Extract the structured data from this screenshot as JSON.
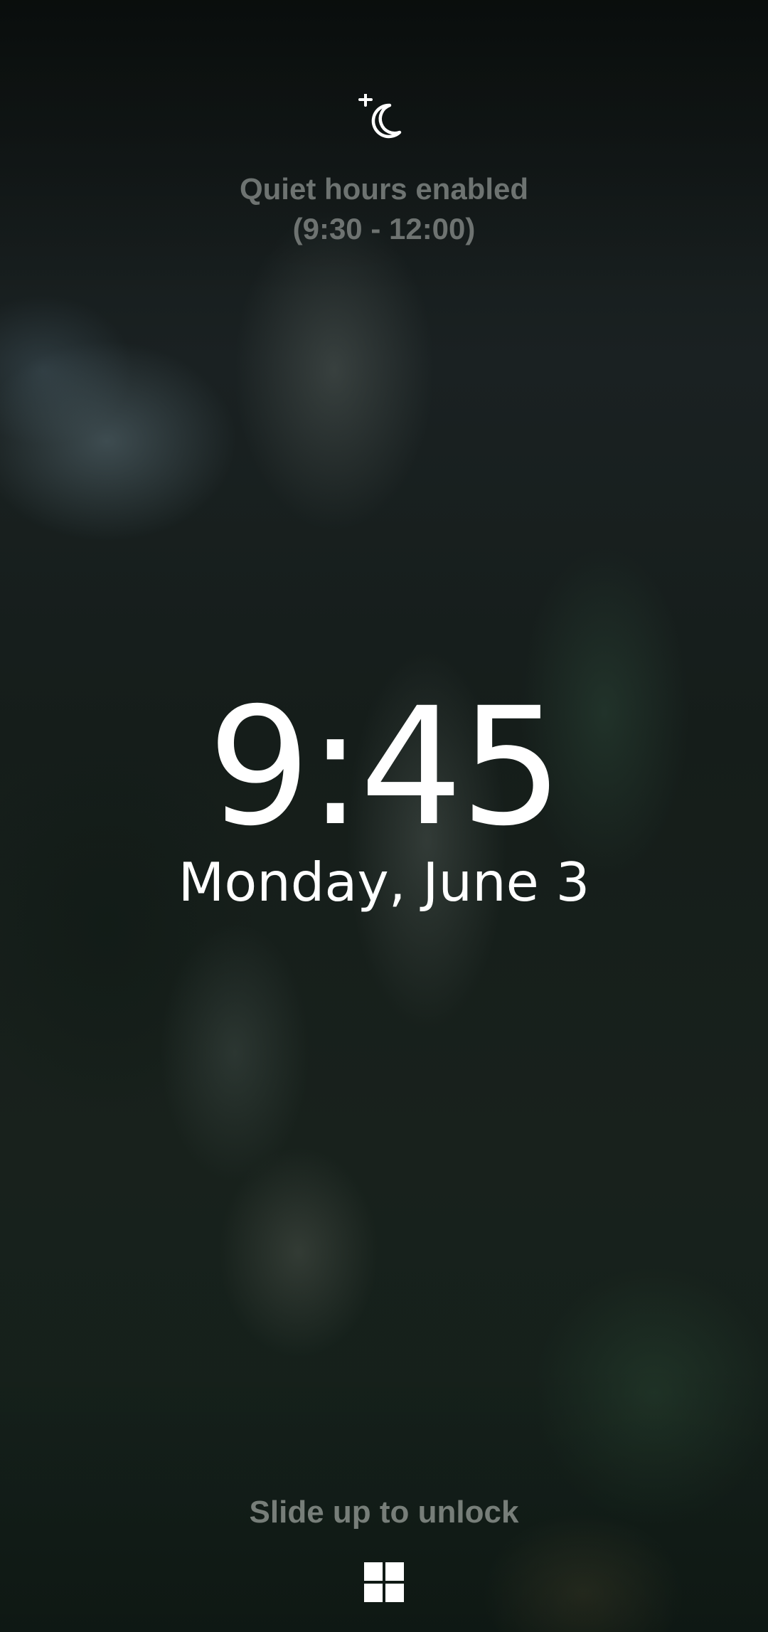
{
  "lock_screen": {
    "quiet_hours": {
      "icon": "moon-sparkle-icon",
      "line1": "Quiet hours enabled",
      "line2": "(9:30 - 12:00)"
    },
    "time": "9:45",
    "date": "Monday, June 3",
    "unlock_hint": "Slide up to unlock",
    "start_icon": "windows-logo-icon"
  },
  "colors": {
    "clock_text": "#ffffff",
    "dim_text": "#767b78"
  }
}
